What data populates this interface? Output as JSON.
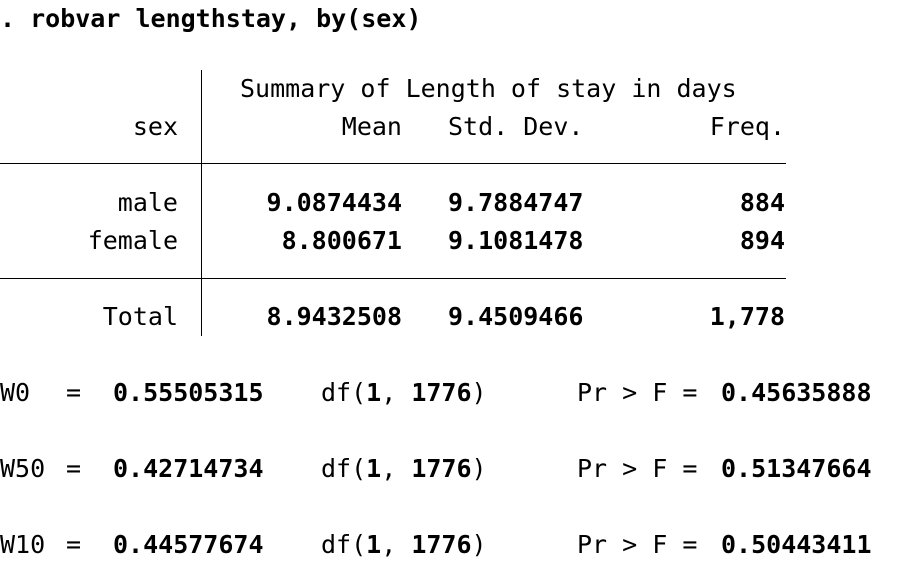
{
  "command": ". robvar lengthstay, by(sex)",
  "table": {
    "summary_title": "Summary of Length of stay in days",
    "row_header": "sex",
    "columns": [
      "Mean",
      "Std. Dev.",
      "Freq."
    ],
    "rows": [
      {
        "label": "male",
        "mean": "9.0874434",
        "sd": "9.7884747",
        "freq": "884"
      },
      {
        "label": "female",
        "mean": "8.800671",
        "sd": "9.1081478",
        "freq": "894"
      }
    ],
    "total": {
      "label": "Total",
      "mean": "8.9432508",
      "sd": "9.4509466",
      "freq": "1,778"
    }
  },
  "stats": [
    {
      "name": "W0",
      "value": "0.55505315",
      "df1": "1",
      "df2": "1776",
      "pr_label": "Pr > F =",
      "p": "0.45635888"
    },
    {
      "name": "W50",
      "value": "0.42714734",
      "df1": "1",
      "df2": "1776",
      "pr_label": "Pr > F =",
      "p": "0.51347664"
    },
    {
      "name": "W10",
      "value": "0.44577674",
      "df1": "1",
      "df2": "1776",
      "pr_label": "Pr > F =",
      "p": "0.50443411"
    }
  ]
}
